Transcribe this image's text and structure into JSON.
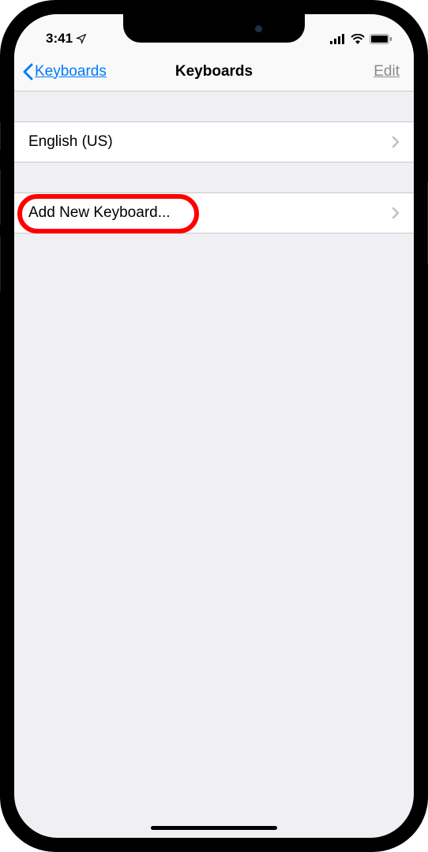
{
  "status": {
    "time": "3:41",
    "location_icon": "location-arrow-icon"
  },
  "nav": {
    "back_label": "Keyboards",
    "title": "Keyboards",
    "edit_label": "Edit"
  },
  "rows": {
    "keyboard_0": "English (US)",
    "add_new": "Add New Keyboard..."
  }
}
